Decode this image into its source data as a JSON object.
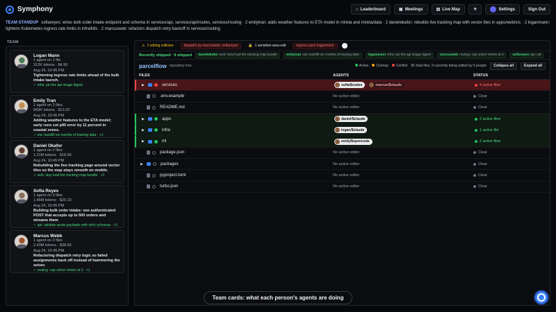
{
  "app": {
    "title": "Symphony"
  },
  "nav": {
    "leaderboard": "Leaderboard",
    "meetings": "Meetings",
    "live_map": "Live Map",
    "settings": "Settings",
    "sign_out": "Sign Out"
  },
  "standup": {
    "label": "TEAM STANDUP",
    "text": "sofiareyes: wires bulk order intake endpoint and schema in services/api, services/api/routes, services/routing · 2 emilytran: adds weather features to ETA model in ml/eta and ml/eta/data · 2 danielokafor: rebuilds live tracking map with vector tiles in apps/web/src · 2 loganmann: tightens Kubernetes ingress rate limits in infra/k8s · 2 marcusweb: refactors dispatch retry backoff in services/routing"
  },
  "team": {
    "label": "TEAM",
    "members": [
      {
        "name": "Logan Mann",
        "agents": "1 agent on 1 file",
        "tokens": "312K tokens · $4.90",
        "time": "Aug 24, 10:45 PM",
        "task": "Tightening ingress rate limits ahead of the bulk intake launch.",
        "branch": "✓ infra: pin the api image digest",
        "color": "#4a7c59"
      },
      {
        "name": "Emily Tran",
        "agents": "1 agent on 2 files",
        "tokens": "843K tokens · $13.20",
        "time": "Aug 24, 10:45 PM",
        "task": "Adding weather features to the ETA model; early runs cut p90 error by 11 percent in coastal zones.",
        "branch": "✓ eta: backfill six months of training data · +1",
        "color": "#c58b4e"
      },
      {
        "name": "Daniel Okafor",
        "agents": "1 agent on 2 files",
        "tokens": "1.21M tokens · $18.90",
        "time": "Aug 24, 10:45 PM",
        "task": "Rebuilding the live tracking page around vector tiles so the map stays smooth on mobile.",
        "branch": "✓ web: lazy-load the tracking map bundle · +1",
        "color": "#5c3b2e"
      },
      {
        "name": "Sofia Reyes",
        "agents": "1 agent on 3 files",
        "tokens": "1.86M tokens · $29.10",
        "time": "Aug 24, 10:45 PM",
        "task": "Building bulk order intake: one authenticated POST that accepts up to 500 orders and streams them",
        "branch": "✓ api: validate quote payloads with strict schemas · +1",
        "color": "#8a6d5a"
      },
      {
        "name": "Marcus Webb",
        "agents": "1 agent on 2 files",
        "tokens": "2.43M tokens · $38.60",
        "time": "Aug 24, 10:45 PM",
        "task": "Refactoring dispatch retry logic so failed assignments back off instead of hammering the solver.",
        "branch": "✓ routing: cap solver retries at 3 · +1",
        "color": "#a0522d"
      }
    ]
  },
  "alerts": {
    "collision": "1 editing collision",
    "collision_files": "dispatch.py  marcusweb, sofiareyes",
    "sensitive": "1 sensitive-area edit",
    "sensitive_file": "ingress.yaml  loganmann"
  },
  "shipped": {
    "label": "Recently shipped · 9 shipped",
    "items": [
      {
        "user": "danielokafor",
        "text": "web: lazy-load the tracking map bundle"
      },
      {
        "user": "emilytran",
        "text": "eta: backfill six months of training data"
      },
      {
        "user": "loganmann",
        "text": "infra: pin the api image digest"
      },
      {
        "user": "marcusweb",
        "text": "routing: cap solver retries at 3"
      },
      {
        "user": "sofiareyes",
        "text": "api: val"
      }
    ]
  },
  "repo": {
    "name": "parcelflow",
    "sub": "repository tree",
    "legend_active": "Active",
    "legend_overlap": "Overlap",
    "legend_conflict": "Conflict",
    "summary": "85 total files, 9 currently being edited by 5 people",
    "collapse_all": "Collapse all",
    "expand_all": "Expand all"
  },
  "columns": {
    "files": "FILES",
    "agents": "AGENTS",
    "status": "STATUS"
  },
  "tree": [
    {
      "name": "services",
      "type": "folder",
      "state": "conflict",
      "agents": [
        "sofia/$codex",
        "marcus/$claude"
      ],
      "status": "4 active files"
    },
    {
      "name": ".env.example",
      "type": "file",
      "state": "none",
      "agents": [],
      "agent_text": "No active editor",
      "status": "Clear"
    },
    {
      "name": "README.md",
      "type": "file",
      "state": "none",
      "agents": [],
      "agent_text": "No active editor",
      "status": "Clear"
    },
    {
      "name": "apps",
      "type": "folder",
      "state": "active",
      "agents": [
        "daniel/$claude"
      ],
      "status": "2 active files"
    },
    {
      "name": "infra",
      "type": "folder",
      "state": "active",
      "agents": [
        "logan/$claude"
      ],
      "status": "1 active file"
    },
    {
      "name": "ml",
      "type": "folder",
      "state": "active",
      "agents": [
        "emily/$opencode"
      ],
      "status": "2 active files"
    },
    {
      "name": "package.json",
      "type": "file",
      "state": "none",
      "agents": [],
      "agent_text": "No active editor",
      "status": "Clear"
    },
    {
      "name": "packages",
      "type": "folder",
      "state": "none",
      "agents": [],
      "agent_text": "No active editor",
      "status": "Clear"
    },
    {
      "name": "pyproject.toml",
      "type": "file",
      "state": "none",
      "agents": [],
      "agent_text": "No active editor",
      "status": "Clear"
    },
    {
      "name": "turbo.json",
      "type": "file",
      "state": "none",
      "agents": [],
      "agent_text": "No active editor",
      "status": "Clear"
    }
  ],
  "banner": "Team cards: what each person's agents are doing"
}
